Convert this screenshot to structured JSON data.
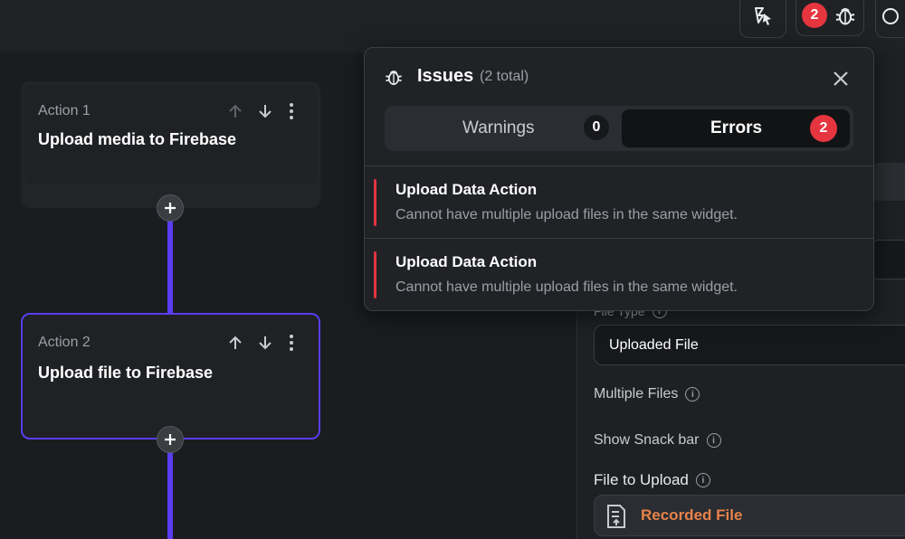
{
  "topbar": {
    "error_count": "2"
  },
  "actions": [
    {
      "label": "Action 1",
      "title": "Upload media to Firebase"
    },
    {
      "label": "Action 2",
      "title": "Upload file to Firebase"
    }
  ],
  "issues_panel": {
    "title": "Issues",
    "subtitle": "(2 total)",
    "tabs": {
      "warnings_label": "Warnings",
      "warnings_count": "0",
      "errors_label": "Errors",
      "errors_count": "2",
      "active": "Errors"
    },
    "items": [
      {
        "title": "Upload Data Action",
        "description": "Cannot have multiple upload files in the same widget."
      },
      {
        "title": "Upload Data Action",
        "description": "Cannot have multiple upload files in the same widget."
      }
    ]
  },
  "properties": {
    "file_type_label": "File Type",
    "file_type_value": "Uploaded File",
    "multiple_files_label": "Multiple Files",
    "show_snackbar_label": "Show Snack bar",
    "file_to_upload_label": "File to Upload",
    "file_to_upload_value": "Recorded File"
  },
  "colors": {
    "accent": "#5a3df0",
    "error": "#e5353f",
    "recorded_file": "#e8824a"
  }
}
